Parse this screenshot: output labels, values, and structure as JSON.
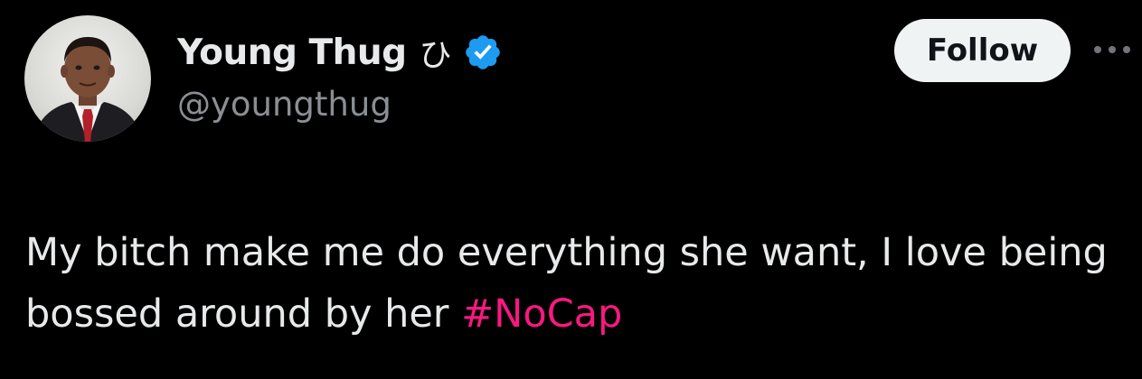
{
  "author": {
    "display_name": "Young Thug",
    "name_glyph": "ひ",
    "handle": "@youngthug",
    "verified": true,
    "avatar_icon": "profile-photo"
  },
  "actions": {
    "follow_label": "Follow",
    "more_icon": "more-horizontal-icon"
  },
  "tweet": {
    "text_before_hashtag": "My bitch make me do everything she want, I love being bossed around by her ",
    "hashtag": "#NoCap"
  },
  "colors": {
    "background": "#000000",
    "text": "#e7e9ea",
    "secondary_text": "#8b8f94",
    "verified_badge": "#1d9bf0",
    "hashtag": "#f91880",
    "follow_button_bg": "#eff3f4"
  }
}
